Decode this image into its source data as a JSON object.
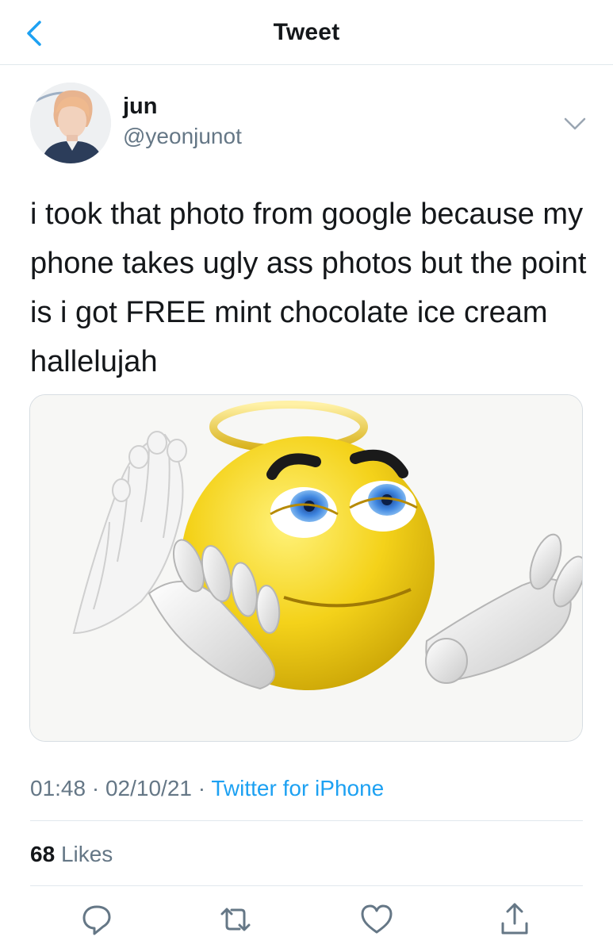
{
  "header": {
    "title": "Tweet",
    "back_icon": "chevron-left-icon"
  },
  "author": {
    "display_name": "jun",
    "handle": "@yeonjunot"
  },
  "tweet": {
    "text": "i took that photo from google because my phone takes ugly ass photos but the point is i got FREE mint chocolate ice cream hallelujah",
    "media": "angel emoji (yellow face with halo, wings and praying hands)"
  },
  "meta": {
    "time": "01:48",
    "sep1": " · ",
    "date": "02/10/21",
    "sep2": " · ",
    "source": "Twitter for iPhone"
  },
  "stats": {
    "likes_count": "68",
    "likes_label": "Likes"
  },
  "actions": [
    "reply-icon",
    "retweet-icon",
    "like-icon",
    "share-icon"
  ],
  "colors": {
    "accent": "#1da1f2",
    "secondary_text": "#657786",
    "border": "#e1e8ed"
  }
}
